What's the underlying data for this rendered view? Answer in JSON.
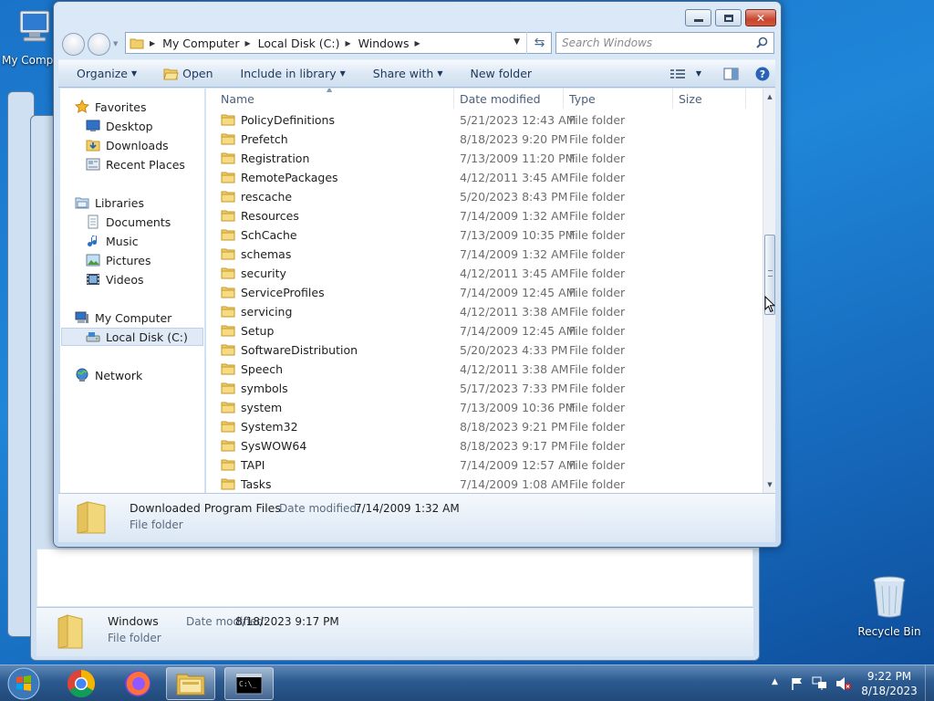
{
  "desktop": {
    "my_computer_label": "My Compu",
    "recycle_bin_label": "Recycle Bin"
  },
  "background_window": {
    "details_name": "Windows",
    "details_date_label": "Date modified:",
    "details_date_value": "8/18/2023 9:17 PM",
    "details_type": "File folder"
  },
  "explorer": {
    "address": [
      "My Computer",
      "Local Disk (C:)",
      "Windows"
    ],
    "search_placeholder": "Search Windows",
    "toolbar": {
      "organize": "Organize",
      "open": "Open",
      "include": "Include in library",
      "share": "Share with",
      "new_folder": "New folder"
    },
    "nav": {
      "favorites": "Favorites",
      "desktop": "Desktop",
      "downloads": "Downloads",
      "recent": "Recent Places",
      "libraries": "Libraries",
      "documents": "Documents",
      "music": "Music",
      "pictures": "Pictures",
      "videos": "Videos",
      "computer": "My Computer",
      "local_disk": "Local Disk (C:)",
      "network": "Network"
    },
    "columns": {
      "name": "Name",
      "date": "Date modified",
      "type": "Type",
      "size": "Size"
    },
    "rows": [
      {
        "name": "PolicyDefinitions",
        "date": "5/21/2023 12:43 AM",
        "type": "File folder"
      },
      {
        "name": "Prefetch",
        "date": "8/18/2023 9:20 PM",
        "type": "File folder"
      },
      {
        "name": "Registration",
        "date": "7/13/2009 11:20 PM",
        "type": "File folder"
      },
      {
        "name": "RemotePackages",
        "date": "4/12/2011 3:45 AM",
        "type": "File folder"
      },
      {
        "name": "rescache",
        "date": "5/20/2023 8:43 PM",
        "type": "File folder"
      },
      {
        "name": "Resources",
        "date": "7/14/2009 1:32 AM",
        "type": "File folder"
      },
      {
        "name": "SchCache",
        "date": "7/13/2009 10:35 PM",
        "type": "File folder"
      },
      {
        "name": "schemas",
        "date": "7/14/2009 1:32 AM",
        "type": "File folder"
      },
      {
        "name": "security",
        "date": "4/12/2011 3:45 AM",
        "type": "File folder"
      },
      {
        "name": "ServiceProfiles",
        "date": "7/14/2009 12:45 AM",
        "type": "File folder"
      },
      {
        "name": "servicing",
        "date": "4/12/2011 3:38 AM",
        "type": "File folder"
      },
      {
        "name": "Setup",
        "date": "7/14/2009 12:45 AM",
        "type": "File folder"
      },
      {
        "name": "SoftwareDistribution",
        "date": "5/20/2023 4:33 PM",
        "type": "File folder"
      },
      {
        "name": "Speech",
        "date": "4/12/2011 3:38 AM",
        "type": "File folder"
      },
      {
        "name": "symbols",
        "date": "5/17/2023 7:33 PM",
        "type": "File folder"
      },
      {
        "name": "system",
        "date": "7/13/2009 10:36 PM",
        "type": "File folder"
      },
      {
        "name": "System32",
        "date": "8/18/2023 9:21 PM",
        "type": "File folder"
      },
      {
        "name": "SysWOW64",
        "date": "8/18/2023 9:17 PM",
        "type": "File folder"
      },
      {
        "name": "TAPI",
        "date": "7/14/2009 12:57 AM",
        "type": "File folder"
      },
      {
        "name": "Tasks",
        "date": "7/14/2009 1:08 AM",
        "type": "File folder"
      }
    ],
    "details": {
      "name": "Downloaded Program Files",
      "date_label": "Date modified:",
      "date_value": "7/14/2009 1:32 AM",
      "type": "File folder"
    }
  },
  "taskbar": {
    "time": "9:22 PM",
    "date": "8/18/2023"
  }
}
